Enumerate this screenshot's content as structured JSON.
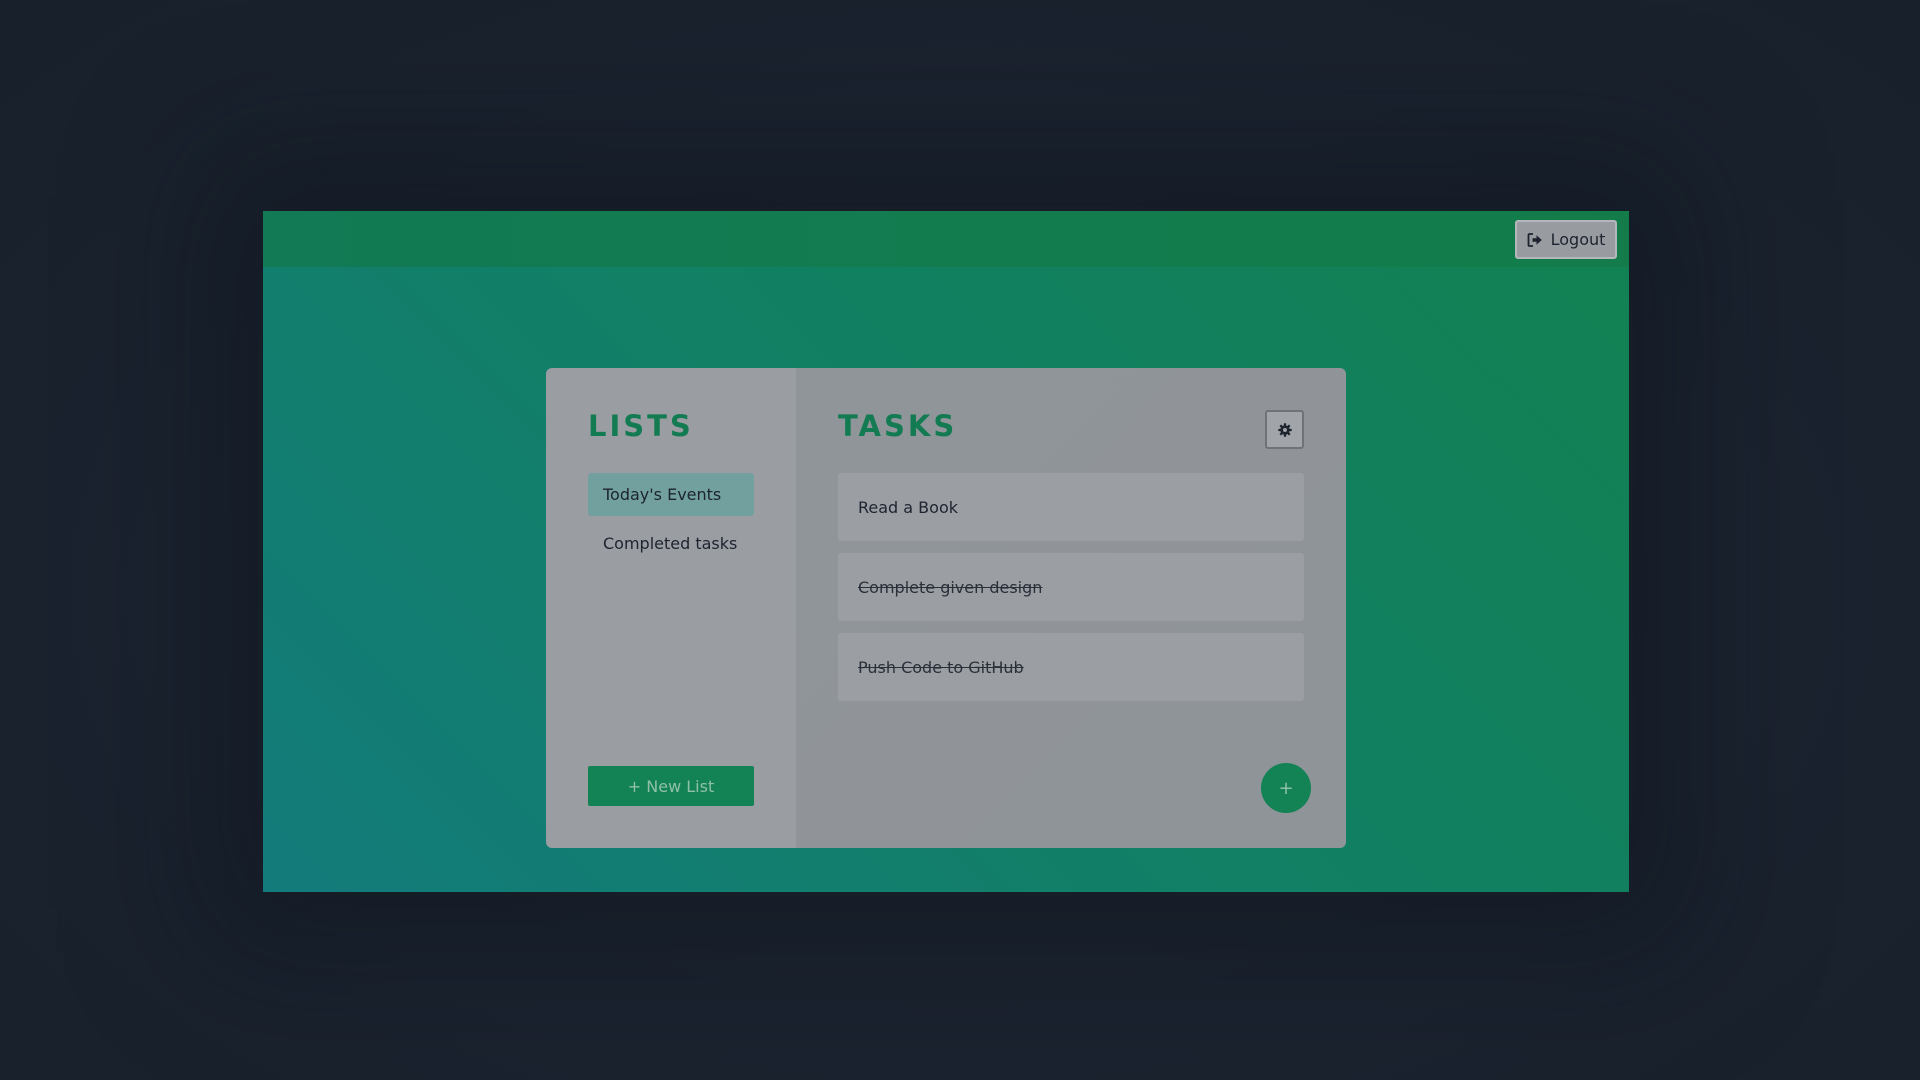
{
  "header": {
    "logout_label": "Logout",
    "logout_icon": "logout-icon"
  },
  "lists_panel": {
    "title": "LISTS",
    "items": [
      {
        "label": "Today's Events",
        "active": true
      },
      {
        "label": "Completed tasks",
        "active": false
      }
    ],
    "new_list_label": "+ New List"
  },
  "tasks_panel": {
    "title": "TASKS",
    "settings_icon": "gear-icon",
    "tasks": [
      {
        "text": "Read a Book",
        "completed": false
      },
      {
        "text": "Complete given design",
        "completed": true
      },
      {
        "text": "Push Code to GitHub",
        "completed": true
      }
    ],
    "add_task_label": "+"
  },
  "colors": {
    "accent": "#137b52",
    "button_green": "#138255",
    "active_list_bg": "#72a09f",
    "panel_gray": "#9a9da2",
    "page_background": "#1b2330"
  }
}
